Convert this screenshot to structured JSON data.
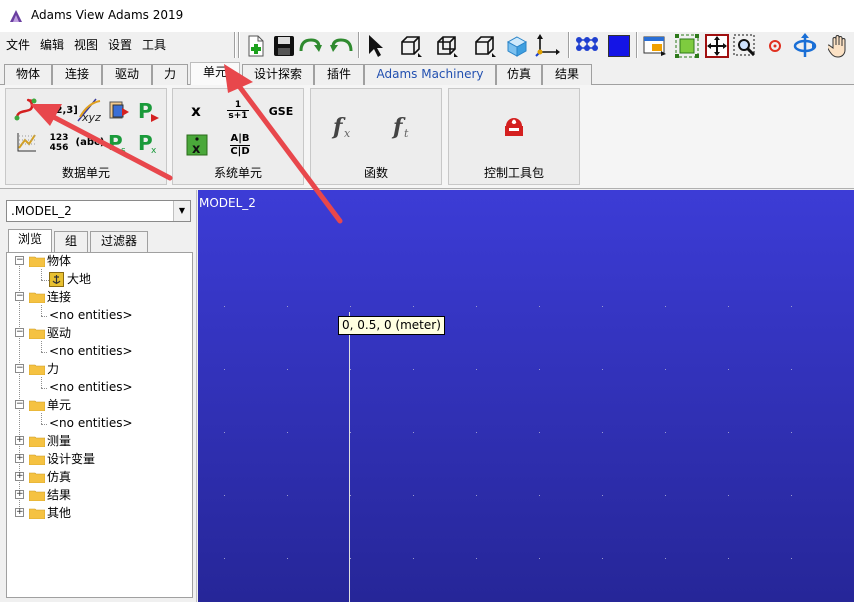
{
  "window": {
    "title": "Adams View Adams 2019",
    "app_icon": "adams-logo-icon"
  },
  "menubar": {
    "items": [
      "文件",
      "编辑",
      "视图",
      "设置",
      "工具"
    ]
  },
  "toolbar": {
    "buttons": [
      "new-model-icon",
      "save-icon",
      "redo-icon",
      "undo-icon",
      "select-arrow-icon",
      "front-view-icon",
      "iso-view-icon",
      "wireframe-view-icon",
      "shaded-view-icon",
      "triad-icon",
      "grid-icon",
      "color-swatch-icon",
      "render-icon",
      "fit-icon",
      "zoom-fit-icon",
      "zoom-box-icon",
      "rotate-center-icon",
      "rotate-icon",
      "pan-hand-icon"
    ],
    "color_swatch": "#1414e6"
  },
  "tabs": [
    {
      "label": "物体",
      "active": false
    },
    {
      "label": "连接",
      "active": false
    },
    {
      "label": "驱动",
      "active": false
    },
    {
      "label": "力",
      "active": false
    },
    {
      "label": "单元",
      "active": true
    },
    {
      "label": "设计探索",
      "active": false
    },
    {
      "label": "插件",
      "active": false
    },
    {
      "label": "Adams Machinery",
      "active": false
    },
    {
      "label": "仿真",
      "active": false
    },
    {
      "label": "结果",
      "active": false
    }
  ],
  "ribbon": {
    "groups": [
      {
        "label": "数据单元",
        "buttons": [
          "spline-icon",
          "array-icon",
          "point-curve-icon",
          "export-icon",
          "plant-input-icon",
          "curve-data-icon",
          "matrix-icon",
          "string-icon",
          "plant-state-icon",
          "plant-output-icon"
        ],
        "array_text": "[1,2,3]",
        "xyz_text": "xyz",
        "matrix_text": "123\n456",
        "string_text": "(abc)"
      },
      {
        "label": "系统单元",
        "buttons": [
          "state-variable-icon",
          "transfer-function-icon",
          "gse-icon",
          "differential-eq-icon",
          "linear-state-icon"
        ],
        "x_text": "x",
        "tf_num": "1",
        "tf_den": "s+1",
        "gse_text": "GSE",
        "abcd_top": "A|B",
        "abcd_bottom": "C|D"
      },
      {
        "label": "函数",
        "buttons": [
          "function-builder-icon",
          "function-time-icon"
        ]
      },
      {
        "label": "控制工具包",
        "buttons": [
          "control-toolkit-icon"
        ]
      }
    ]
  },
  "left_pane": {
    "model_select": ".MODEL_2",
    "subtabs": [
      {
        "label": "浏览",
        "active": true
      },
      {
        "label": "组",
        "active": false
      },
      {
        "label": "过滤器",
        "active": false
      }
    ],
    "tree": [
      {
        "label": "物体",
        "level": 0,
        "expander": "−"
      },
      {
        "label": "大地",
        "level": 1,
        "icon": "ground-icon"
      },
      {
        "label": "连接",
        "level": 0,
        "expander": "−"
      },
      {
        "label": "<no entities>",
        "level": 1
      },
      {
        "label": "驱动",
        "level": 0,
        "expander": "−"
      },
      {
        "label": "<no entities>",
        "level": 1
      },
      {
        "label": "力",
        "level": 0,
        "expander": "−"
      },
      {
        "label": "<no entities>",
        "level": 1
      },
      {
        "label": "单元",
        "level": 0,
        "expander": "−"
      },
      {
        "label": "<no entities>",
        "level": 1
      },
      {
        "label": "测量",
        "level": 0,
        "expander": "+"
      },
      {
        "label": "设计变量",
        "level": 0,
        "expander": "+"
      },
      {
        "label": "仿真",
        "level": 0,
        "expander": "+"
      },
      {
        "label": "结果",
        "level": 0,
        "expander": "+"
      },
      {
        "label": "其他",
        "level": 0,
        "expander": "+"
      }
    ]
  },
  "viewport": {
    "model_label": "MODEL_2",
    "coordinate_tooltip": "0, 0.5, 0 (meter)",
    "background_top": "#3c3cd6",
    "background_bottom": "#262698"
  },
  "annotations": {
    "arrow_color": "#e8474c",
    "arrow_count": 2
  }
}
